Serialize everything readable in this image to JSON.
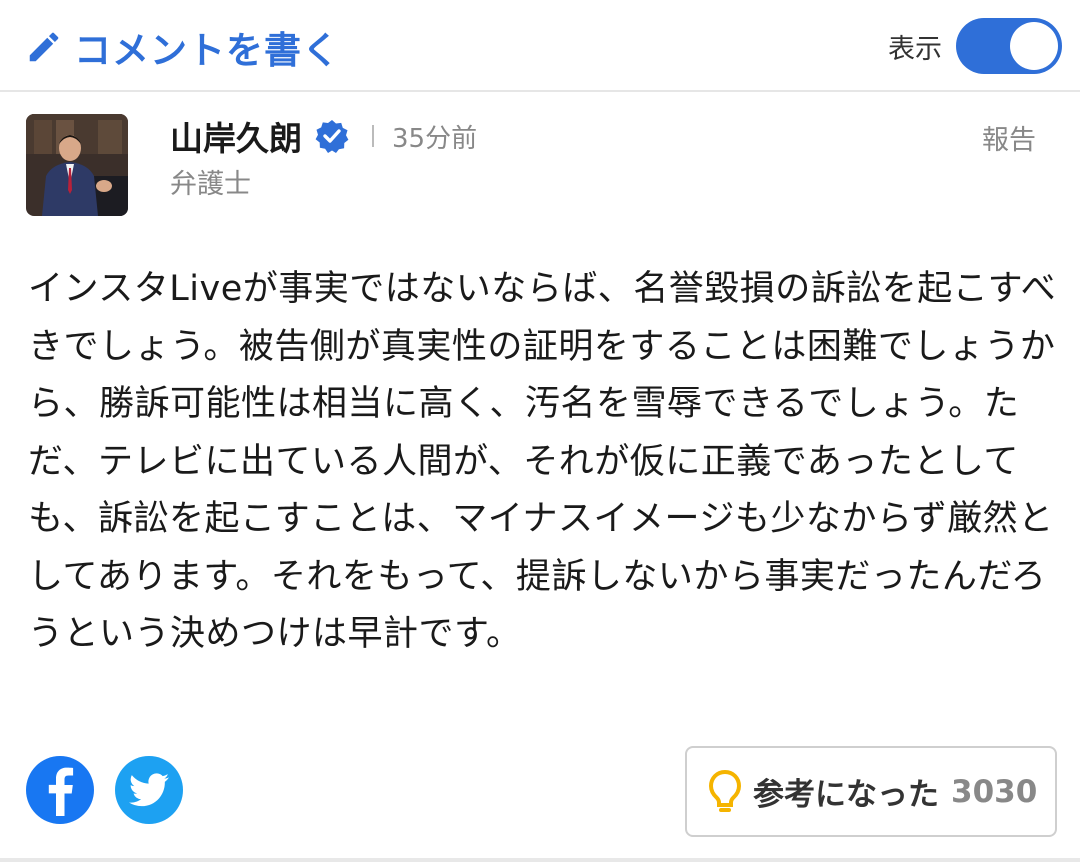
{
  "header": {
    "write_comment_label": "コメントを書く",
    "display_label": "表示",
    "display_on": true,
    "accent_color": "#2f6fd8"
  },
  "comment": {
    "author_name": "山岸久朗",
    "verified_icon": "verified-badge-icon",
    "time": "35分前",
    "author_title": "弁護士",
    "report_label": "報告",
    "body": "インスタLiveが事実ではないならば、名誉毀損の訴訟を起こすべきでしょう。被告側が真実性の証明をすることは困難でしょうから、勝訴可能性は相当に高く、汚名を雪辱できるでしょう。ただ、テレビに出ている人間が、それが仮に正義であったとしても、訴訟を起こすことは、マイナスイメージも少なからず厳然としてあります。それをもって、提訴しないから事実だったんだろうという決めつけは早計です。",
    "share": [
      "facebook-icon",
      "twitter-icon"
    ],
    "helpful_label": "参考になった",
    "helpful_count": "3030"
  }
}
